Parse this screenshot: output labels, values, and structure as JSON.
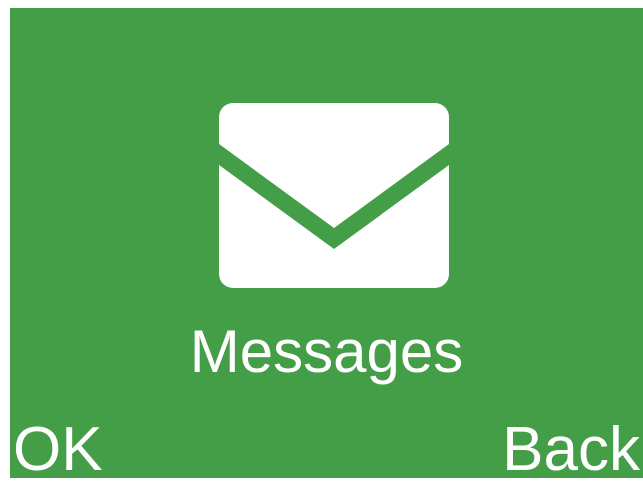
{
  "screen": {
    "background_color": "#449e48",
    "text_color": "#ffffff"
  },
  "app": {
    "icon": "envelope-icon",
    "label": "Messages"
  },
  "softkeys": {
    "left_label": "OK",
    "right_label": "Back"
  }
}
